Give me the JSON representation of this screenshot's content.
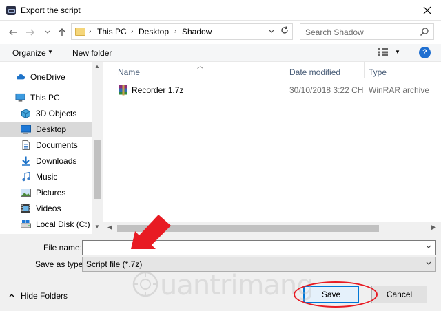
{
  "window": {
    "title": "Export the script"
  },
  "navigation": {
    "breadcrumb": [
      "This PC",
      "Desktop",
      "Shadow"
    ],
    "search_placeholder": "Search Shadow"
  },
  "toolbar": {
    "organize_label": "Organize",
    "new_folder_label": "New folder",
    "help_label": "?"
  },
  "sidebar": {
    "items": [
      {
        "label": "OneDrive",
        "icon": "cloud-icon"
      },
      {
        "label": "This PC",
        "icon": "computer-icon"
      },
      {
        "label": "3D Objects",
        "icon": "cube-icon"
      },
      {
        "label": "Desktop",
        "icon": "desktop-icon",
        "selected": true
      },
      {
        "label": "Documents",
        "icon": "document-icon"
      },
      {
        "label": "Downloads",
        "icon": "download-icon"
      },
      {
        "label": "Music",
        "icon": "music-icon"
      },
      {
        "label": "Pictures",
        "icon": "picture-icon"
      },
      {
        "label": "Videos",
        "icon": "video-icon"
      },
      {
        "label": "Local Disk (C:)",
        "icon": "drive-icon"
      }
    ]
  },
  "file_list": {
    "columns": [
      "Name",
      "Date modified",
      "Type"
    ],
    "rows": [
      {
        "name": "Recorder 1.7z",
        "date": "30/10/2018 3:22 CH",
        "type": "WinRAR archive",
        "icon": "archive-icon"
      }
    ]
  },
  "form": {
    "file_name_label": "File name:",
    "file_name_value": "",
    "save_type_label": "Save as type:",
    "save_type_value": "Script file (*.7z)"
  },
  "footer": {
    "hide_folders_label": "Hide Folders",
    "save_label": "Save",
    "cancel_label": "Cancel"
  },
  "watermark": {
    "text": "uantrimang"
  },
  "colors": {
    "accent": "#0078d7",
    "highlight": "#e81b23",
    "selection": "#d9d9d9"
  }
}
